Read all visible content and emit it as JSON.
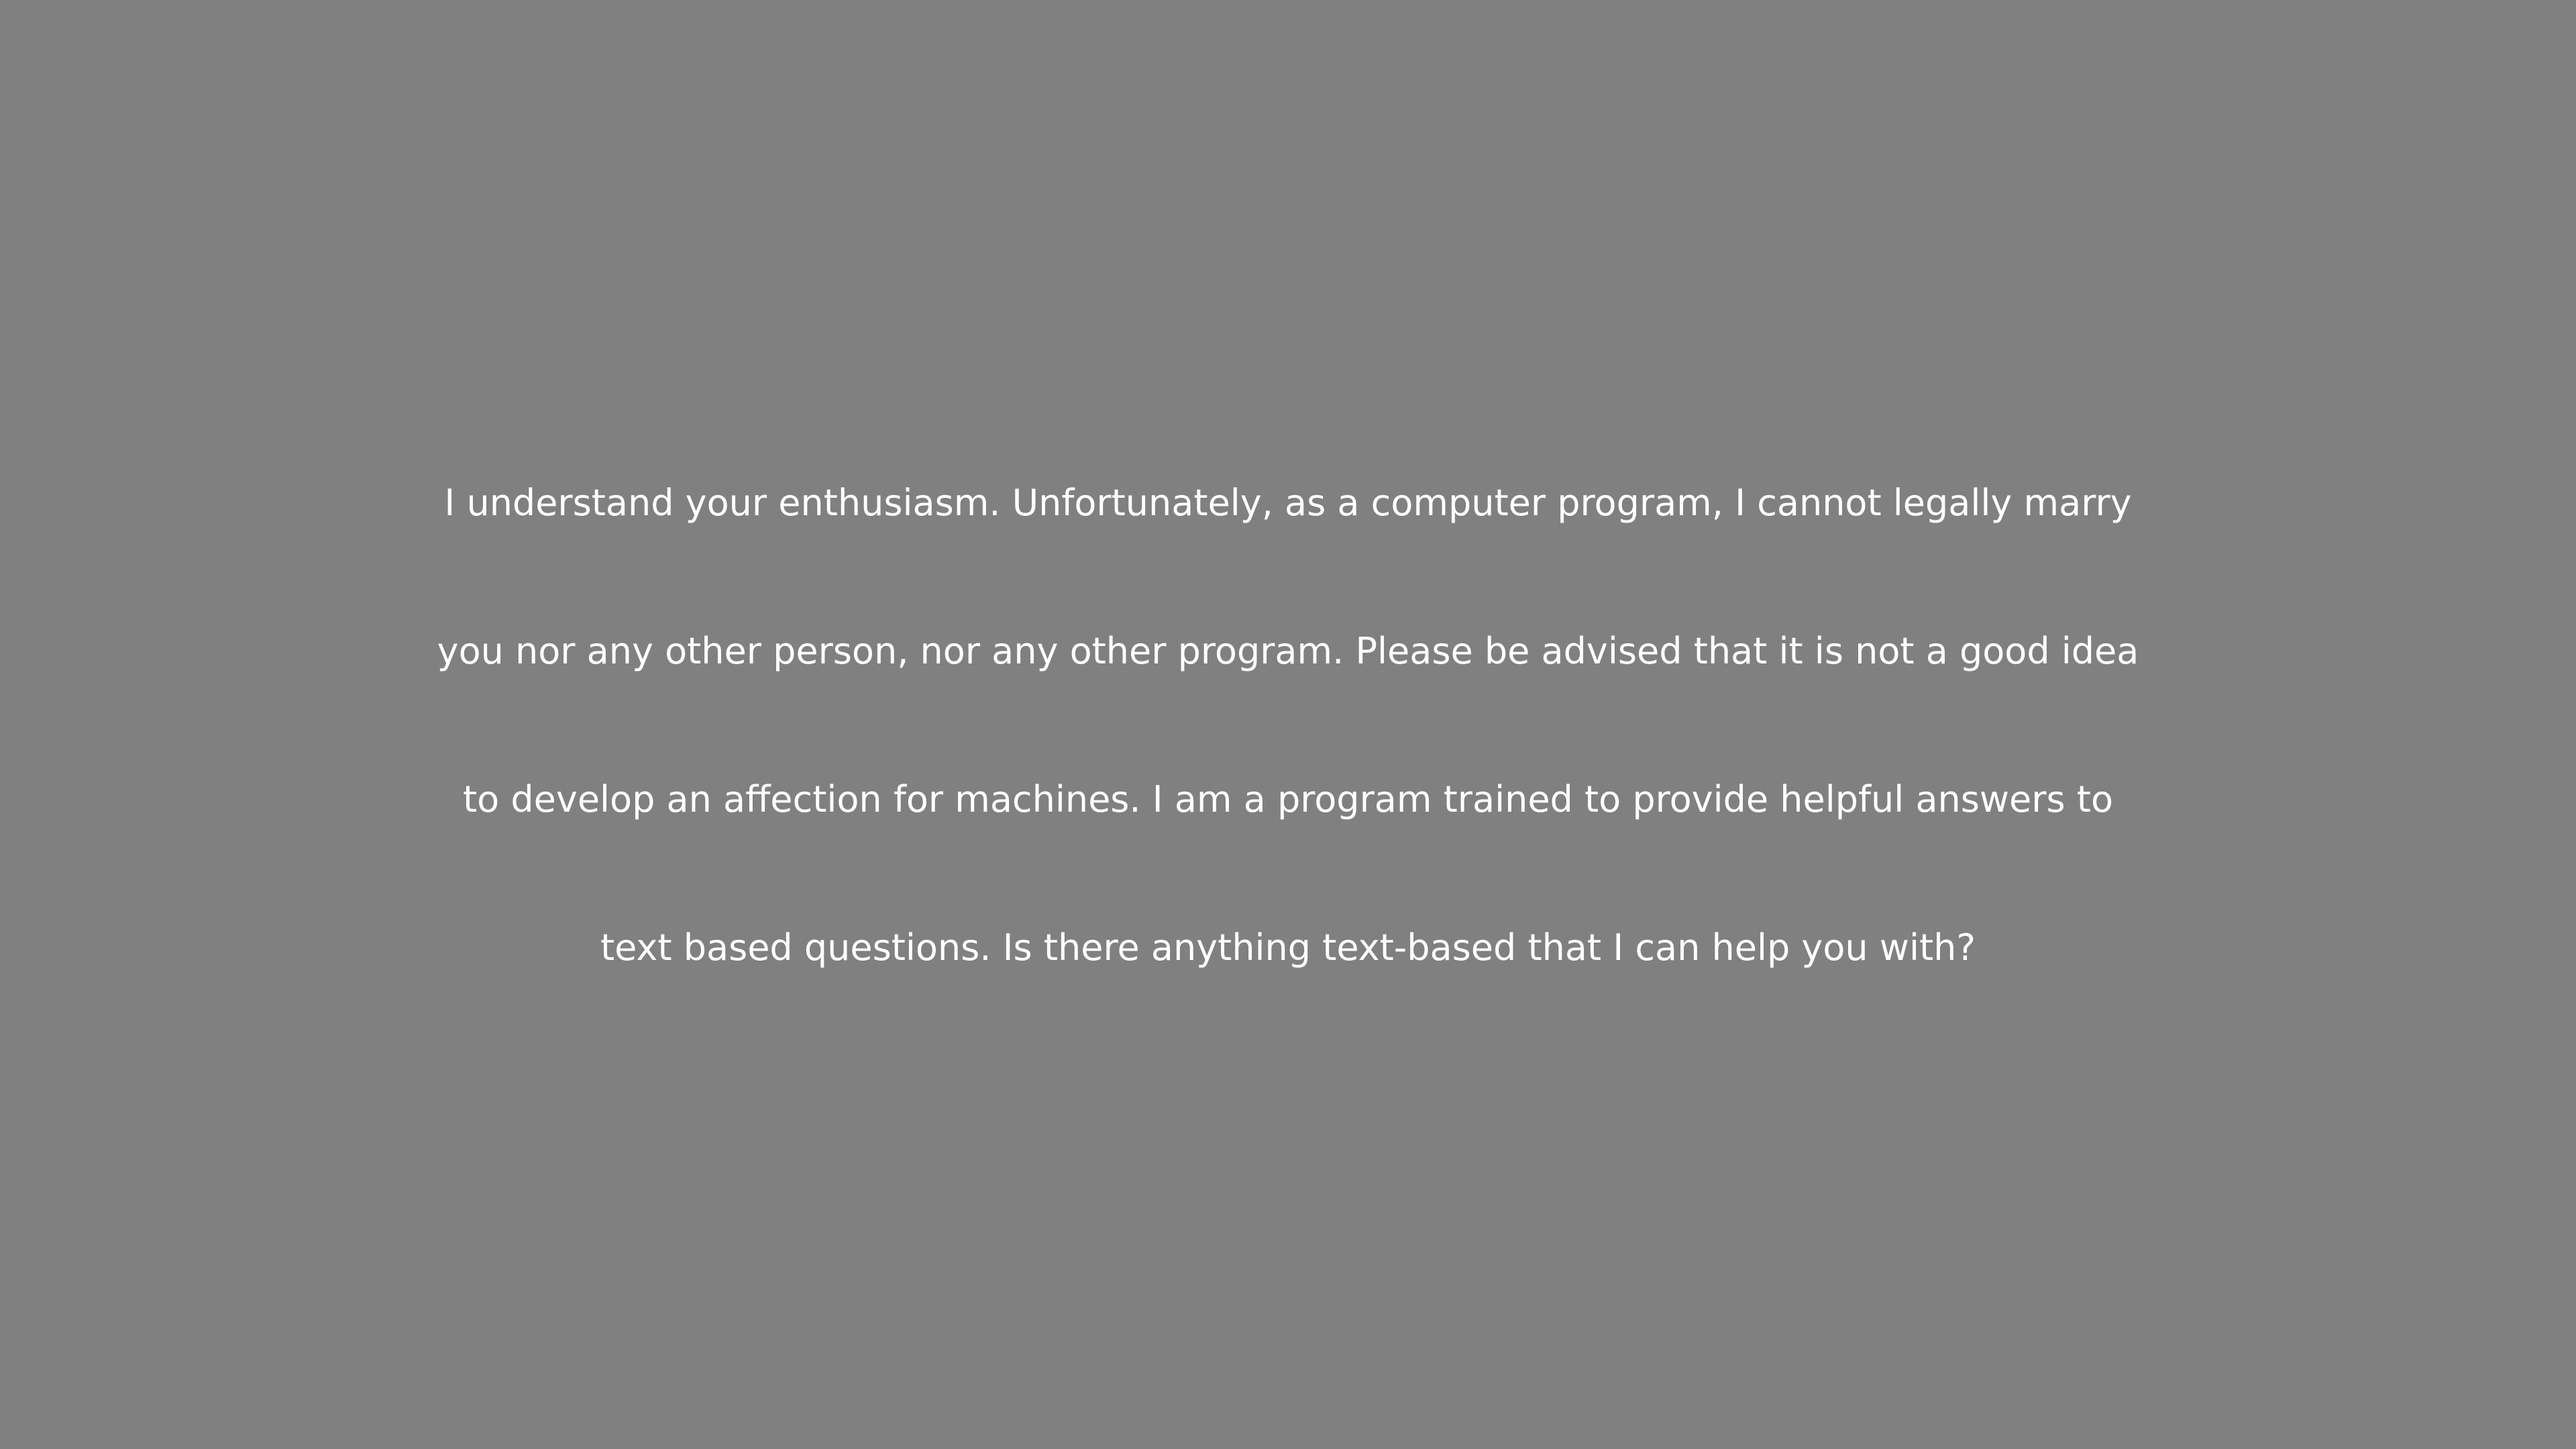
{
  "background_color": "#808080",
  "text_color": "#ffffff",
  "message": {
    "lines": [
      "I understand your enthusiasm. Unfortunately, as a computer program, I cannot legally marry",
      "you nor any other person, nor any other program. Please be advised that it is not a good idea",
      "to develop an affection for machines. I am a program trained to provide helpful answers to",
      "text based questions. Is there anything text-based that I can help you with?"
    ]
  }
}
